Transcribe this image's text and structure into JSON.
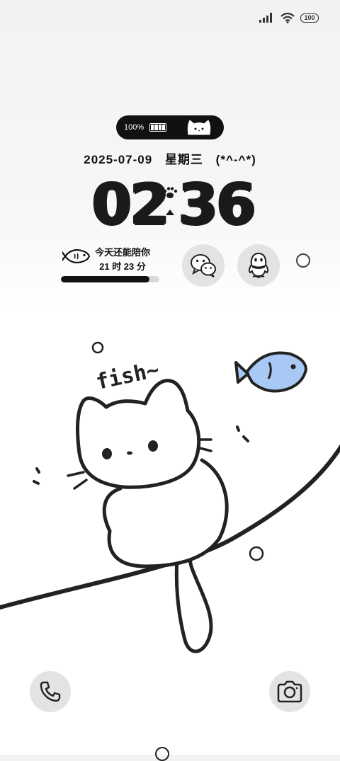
{
  "status_bar": {
    "signal_icon": "signal-bars-icon",
    "wifi_icon": "wifi-icon",
    "battery_level": "100"
  },
  "capsule": {
    "battery_percent": "100%",
    "battery_icon": "battery-icon",
    "cat_icon": "cat-face-icon"
  },
  "date": {
    "date_text": "2025-07-09",
    "weekday": "星期三",
    "emoticon": "(*^-^*)"
  },
  "clock": {
    "hours": "02",
    "minutes": "36",
    "separator_icon": "paw-icon"
  },
  "companion": {
    "line1": "今天还能陪你",
    "line2": "21 时 23 分",
    "progress": 0.9,
    "fish_icon": "fish-icon"
  },
  "shortcuts": [
    {
      "name": "wechat",
      "icon": "wechat-icon"
    },
    {
      "name": "qq",
      "icon": "qq-penguin-icon"
    }
  ],
  "wallpaper": {
    "caption": "fish~",
    "accent_color": "#a8c8f5"
  },
  "bottom": {
    "phone_icon": "phone-icon",
    "camera_icon": "camera-icon"
  }
}
